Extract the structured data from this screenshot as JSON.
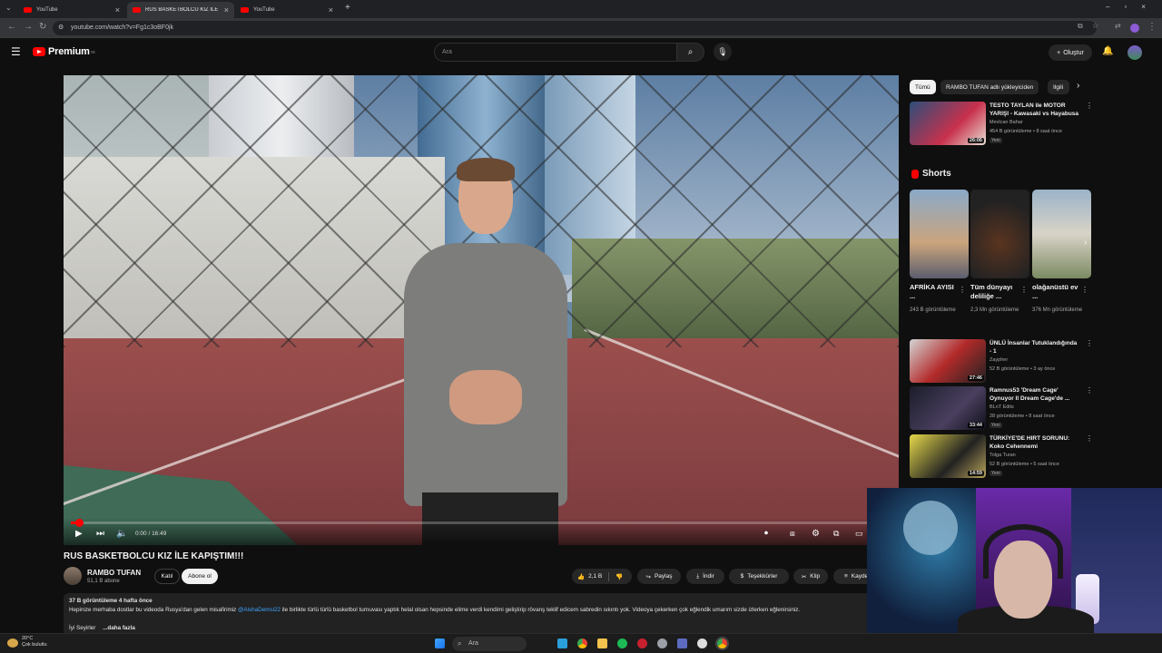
{
  "browser": {
    "tabs": [
      {
        "label": "YouTube",
        "active": false
      },
      {
        "label": "RUS BASKETBOLCU KIZ İLE KAPIŞTIM!!! - YouTube",
        "active": true
      },
      {
        "label": "YouTube",
        "active": false
      }
    ],
    "new_tab": "+",
    "url": "youtube.com/watch?v=Fg1c3oBF0jk"
  },
  "youtube": {
    "logo_text": "Premium",
    "logo_region": "TR",
    "search_placeholder": "Ara",
    "create_label": "Oluştur"
  },
  "player": {
    "time": "0:00 / 16:49",
    "progress_fraction": 0.01
  },
  "video": {
    "title": "RUS BASKETBOLCU KIZ İLE KAPIŞTIM!!!",
    "channel": "RAMBO TUFAN",
    "subscribers": "51,1 B abone",
    "join_label": "Katıl",
    "subscribe_label": "Abone ol",
    "likes": "2,1 B",
    "share_label": "Paylaş",
    "download_label": "İndir",
    "thanks_label": "Teşekkürler",
    "clip_label": "Klip",
    "save_label": "Kaydet",
    "views_date": "37 B görüntüleme  4 hafta önce",
    "description_start": "Hepinize merhaba dostlar bu videoda Rusya'dan gelen misafirimiz ",
    "description_mention": "@AishaDemsi22",
    "description_rest": " ile birlikte türlü türlü basketbol turnuvası yaptık helal olsan hepsinde elime verdi kendimi geliştirip rövanş teklif edicem sabredin sıkıntı yok. Videoya çekerken çok eğlendik umarım sizde izlerken eğlenirsiniz.",
    "description_line2": "İyi Seyirler",
    "more_label": "...daha fazla"
  },
  "sidebar": {
    "chips": [
      {
        "label": "Tümü",
        "selected": true
      },
      {
        "label": "RAMBO TUFAN adlı yükleyiciden",
        "selected": false
      },
      {
        "label": "Ilgili",
        "selected": false
      }
    ],
    "top_video": {
      "title": "TESTO TAYLAN ile MOTOR YARIŞI - Kawasaki vs Hayabusa",
      "channel": "Mevlcan Bahar",
      "views": "454 B görüntüleme • 8 saat önce",
      "badge": "Yeni",
      "duration": "26:06"
    },
    "shorts_title": "Shorts",
    "shorts": [
      {
        "title": "AFRİKA AYISI ...",
        "views": "243 B görüntüleme"
      },
      {
        "title": "Tüm dünyayı deliliğe ...",
        "views": "2,3 Mn görüntüleme"
      },
      {
        "title": "olağanüstü ev ...",
        "views": "376 Mn görüntüleme"
      }
    ],
    "videos": [
      {
        "title": "ÜNLÜ İnsanlar Tutuklandığında - 1",
        "channel": "Zaypher",
        "views": "52 B görüntüleme • 3 ay önce",
        "badge": "",
        "duration": "27:46"
      },
      {
        "title": "Ramnus53 'Dream Cage' Oynuyor ll Dream Cage'de ...",
        "channel": "BLnT Edits",
        "views": "28 görüntüleme • 8 saat önce",
        "badge": "Yeni",
        "duration": "33:44"
      },
      {
        "title": "TÜRKİYE'DE HIRT SORUNU: Koko Cehennemi",
        "channel": "Tolga Turan",
        "views": "52 B görüntüleme • 5 saat önce",
        "badge": "Yeni",
        "duration": "14:59"
      }
    ]
  },
  "taskbar": {
    "temp": "20°C",
    "weather": "Çok bulutlu",
    "search_label": "Ara"
  },
  "icons": [
    "menu-icon",
    "search-icon",
    "mic-icon",
    "plus-icon",
    "bell-icon",
    "play-icon",
    "next-icon",
    "volume-icon",
    "settings-icon",
    "fullscreen-icon",
    "like-icon",
    "dislike-icon",
    "share-icon",
    "download-icon",
    "thanks-icon",
    "clip-icon",
    "save-icon",
    "more-icon",
    "windows-icon"
  ]
}
